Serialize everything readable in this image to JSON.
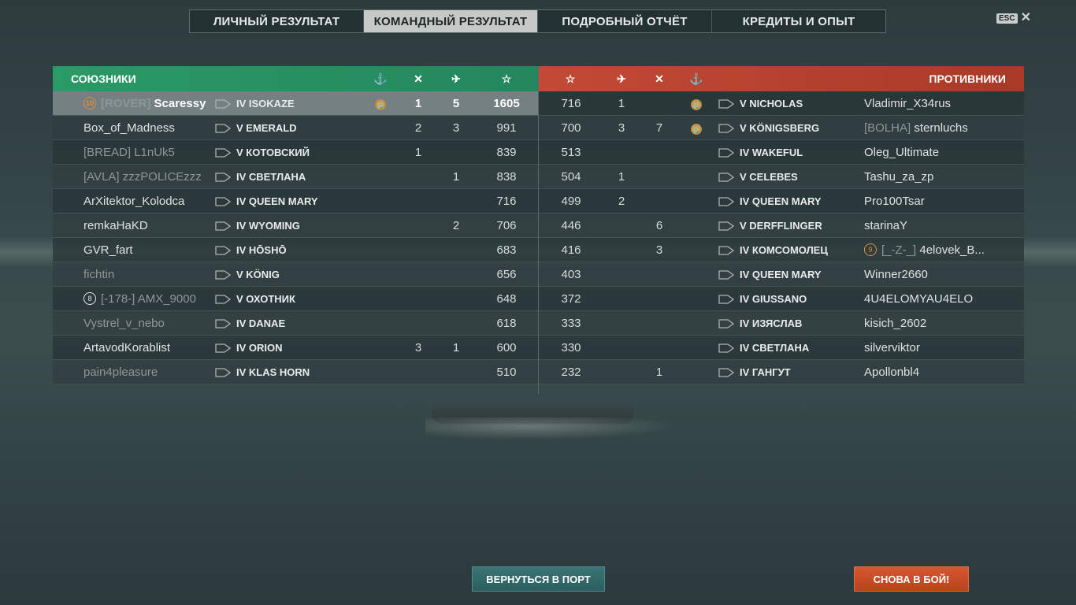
{
  "tabs": [
    {
      "label": "ЛИЧНЫЙ РЕЗУЛЬТАТ"
    },
    {
      "label": "КОМАНДНЫЙ РЕЗУЛЬТАТ"
    },
    {
      "label": "ПОДРОБНЫЙ ОТЧЁТ"
    },
    {
      "label": "КРЕДИТЫ И ОПЫТ"
    }
  ],
  "active_tab": 1,
  "esc_label": "ESC",
  "allies": {
    "title": "СОЮЗНИКИ",
    "color": "#2a9a67",
    "rows": [
      {
        "clan": "[ROVER]",
        "name": "Scaressy",
        "ship": "IV ISOKAZE",
        "medal": "⚓",
        "col1": "1",
        "col2": "5",
        "xp": "1605"
      },
      {
        "clan": "",
        "name": "Box_of_Madness",
        "ship": "V EMERALD",
        "medal": "",
        "col1": "2",
        "col2": "3",
        "xp": "991"
      },
      {
        "clan": "[BREAD]",
        "name": "L1nUk5",
        "ship": "V КОТОВСКИЙ",
        "medal": "",
        "col1": "1",
        "col2": "",
        "xp": "839"
      },
      {
        "clan": "[AVLA]",
        "name": "zzzPOLICEzzz",
        "ship": "IV СВЕТЛАНА",
        "medal": "",
        "col1": "",
        "col2": "1",
        "xp": "838"
      },
      {
        "clan": "",
        "name": "ArXitektor_Kolodca",
        "ship": "IV QUEEN MARY",
        "medal": "",
        "col1": "",
        "col2": "",
        "xp": "716"
      },
      {
        "clan": "",
        "name": "remkaHaKD",
        "ship": "IV WYOMING",
        "medal": "",
        "col1": "",
        "col2": "2",
        "xp": "706"
      },
      {
        "clan": "",
        "name": "GVR_fart",
        "ship": "IV HŌSHŌ",
        "medal": "",
        "col1": "",
        "col2": "",
        "xp": "683"
      },
      {
        "clan": "",
        "name": "fichtin",
        "ship": "V KÖNIG",
        "medal": "",
        "col1": "",
        "col2": "",
        "xp": "656"
      },
      {
        "clan": "[-178-]",
        "name": "AMX_9000",
        "ship": "V ОХОТНИК",
        "medal": "",
        "col1": "",
        "col2": "",
        "xp": "648"
      },
      {
        "clan": "",
        "name": "Vystrel_v_nebo",
        "ship": "IV DANAE",
        "medal": "",
        "col1": "",
        "col2": "",
        "xp": "618"
      },
      {
        "clan": "",
        "name": "ArtavodKorablist",
        "ship": "IV ORION",
        "medal": "",
        "col1": "3",
        "col2": "1",
        "xp": "600"
      },
      {
        "clan": "",
        "name": "pain4pleasure",
        "ship": "IV KLAS HORN",
        "medal": "",
        "col1": "",
        "col2": "",
        "xp": "510"
      }
    ],
    "badges": {
      "0": "10",
      "8": "8"
    }
  },
  "enemies": {
    "title": "ПРОТИВНИКИ",
    "color": "#c24a36",
    "rows": [
      {
        "xp": "716",
        "col2": "1",
        "col1": "",
        "medal": "⚓",
        "ship": "V NICHOLAS",
        "clan": "",
        "name": "Vladimir_X34rus"
      },
      {
        "xp": "700",
        "col2": "3",
        "col1": "7",
        "medal": "⚓",
        "ship": "V KÖNIGSBERG",
        "clan": "[BOLHA]",
        "name": "sternluchs"
      },
      {
        "xp": "513",
        "col2": "",
        "col1": "",
        "medal": "",
        "ship": "IV WAKEFUL",
        "clan": "",
        "name": "Oleg_Ultimate"
      },
      {
        "xp": "504",
        "col2": "1",
        "col1": "",
        "medal": "",
        "ship": "V CELEBES",
        "clan": "",
        "name": "Tashu_za_zp"
      },
      {
        "xp": "499",
        "col2": "2",
        "col1": "",
        "medal": "",
        "ship": "IV QUEEN MARY",
        "clan": "",
        "name": "Pro100Tsar"
      },
      {
        "xp": "446",
        "col2": "",
        "col1": "6",
        "medal": "",
        "ship": "V DERFFLINGER",
        "clan": "",
        "name": "starinaY"
      },
      {
        "xp": "416",
        "col2": "",
        "col1": "3",
        "medal": "",
        "ship": "IV КОМСОМОЛЕЦ",
        "clan": "[_-Z-_]",
        "name": "4elovek_B..."
      },
      {
        "xp": "403",
        "col2": "",
        "col1": "",
        "medal": "",
        "ship": "IV QUEEN MARY",
        "clan": "",
        "name": "Winner2660"
      },
      {
        "xp": "372",
        "col2": "",
        "col1": "",
        "medal": "",
        "ship": "IV GIUSSANO",
        "clan": "",
        "name": "4U4ELOMYAU4ELO"
      },
      {
        "xp": "333",
        "col2": "",
        "col1": "",
        "medal": "",
        "ship": "IV ИЗЯСЛАВ",
        "clan": "",
        "name": "kisich_2602"
      },
      {
        "xp": "330",
        "col2": "",
        "col1": "",
        "medal": "",
        "ship": "IV СВЕТЛАНА",
        "clan": "",
        "name": "silverviktor"
      },
      {
        "xp": "232",
        "col2": "",
        "col1": "1",
        "medal": "",
        "ship": "IV ГАНГУТ",
        "clan": "",
        "name": "Apollonbl4"
      }
    ],
    "badges": {
      "6": "9"
    }
  },
  "buttons": {
    "port": "ВЕРНУТЬСЯ В ПОРТ",
    "battle": "СНОВА В БОЙ!"
  }
}
